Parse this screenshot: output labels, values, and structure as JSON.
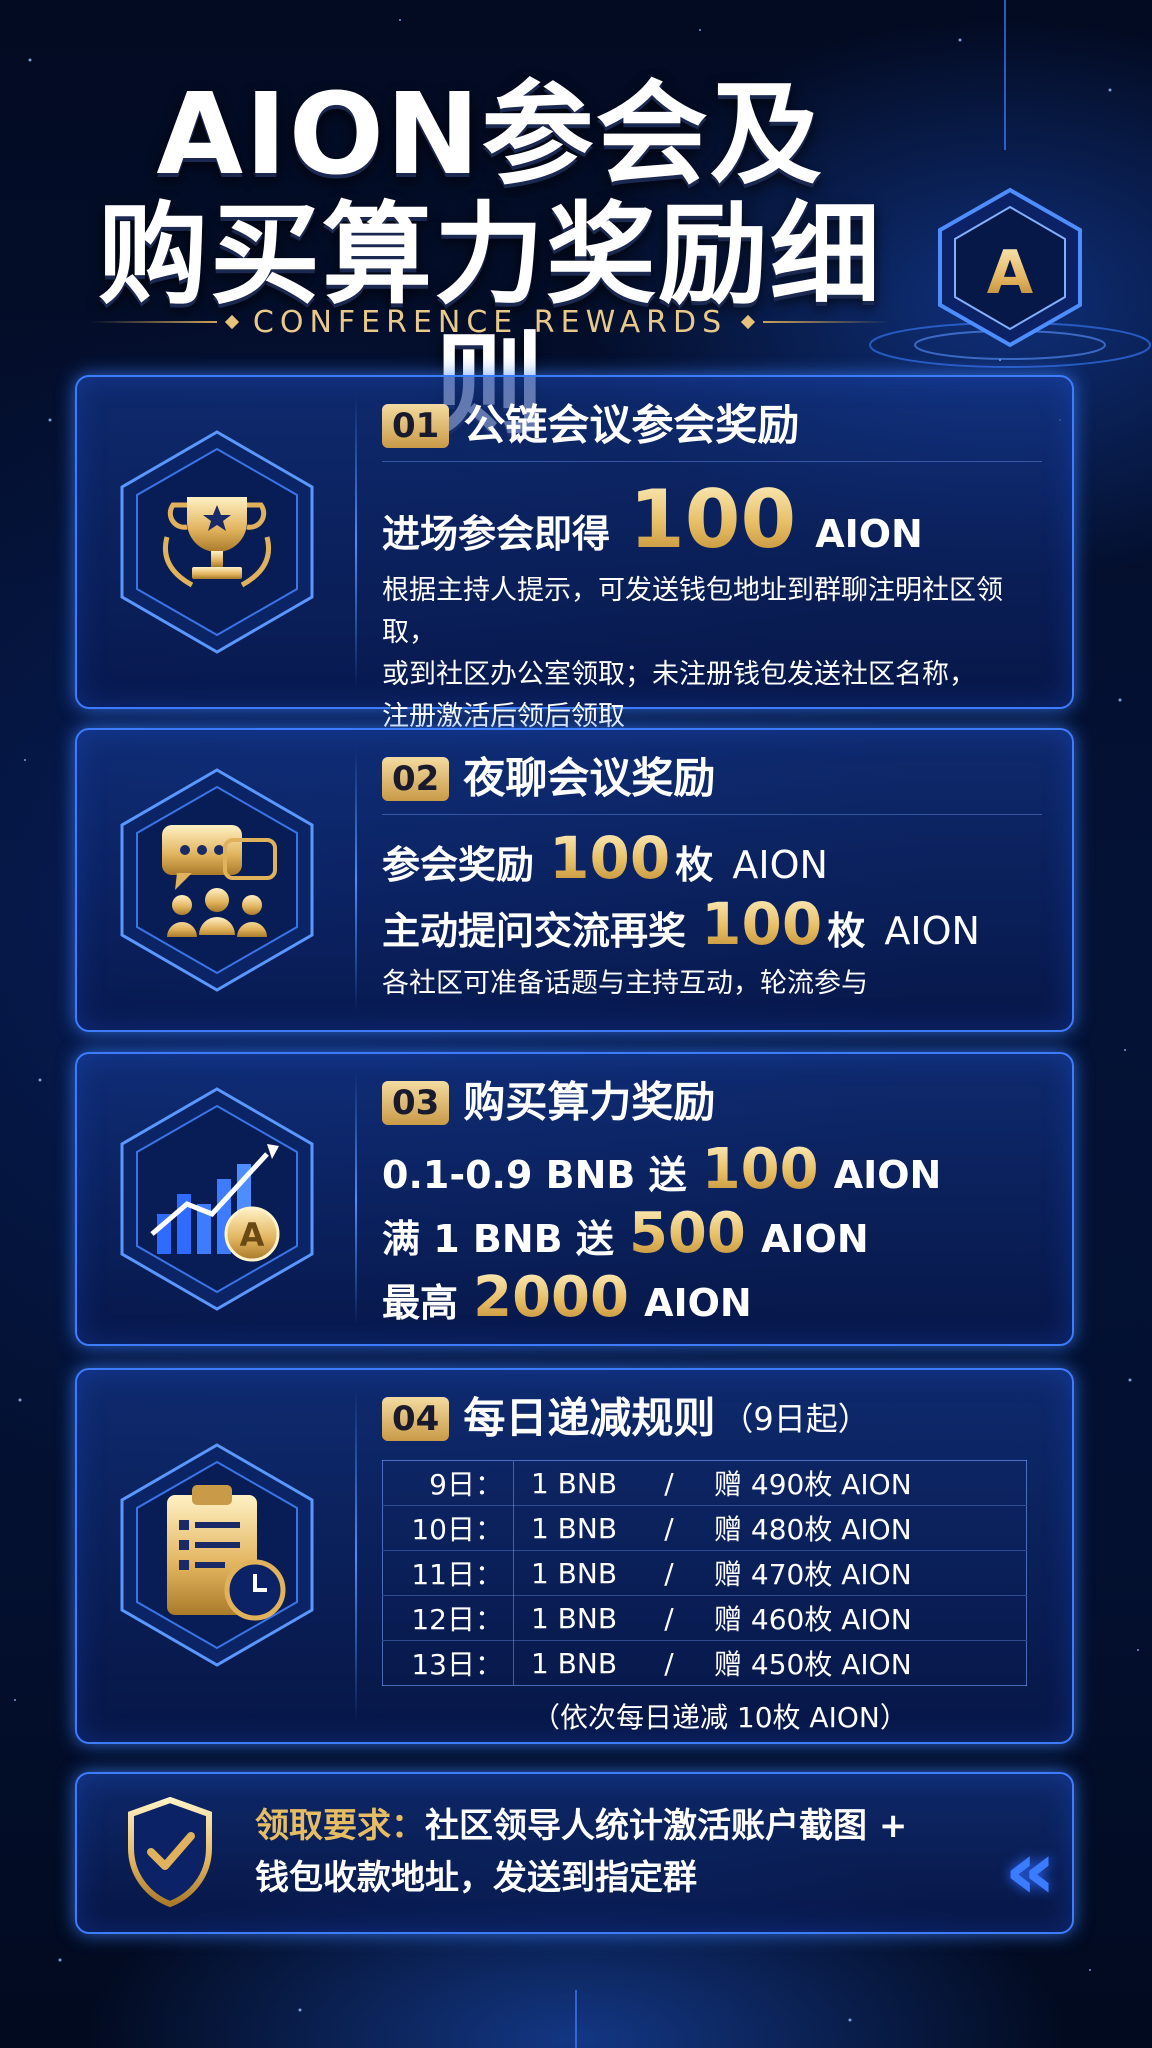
{
  "header": {
    "title_line1": "AION参会及",
    "title_line2": "购买算力奖励细则",
    "subtitle": "CONFERENCE REWARDS",
    "logo_letter": "A"
  },
  "sections": [
    {
      "num": "01",
      "title": "公链会议参会奖励",
      "icon": "trophy-icon",
      "reward_prefix": "进场参会即得",
      "reward_amount": "100",
      "reward_unit": "AION",
      "desc": [
        "根据主持人提示，可发送钱包地址到群聊注明社区领取，",
        "或到社区办公室领取；未注册钱包发送社区名称，",
        "注册激活后领后领取"
      ]
    },
    {
      "num": "02",
      "title": "夜聊会议奖励",
      "icon": "chat-group-icon",
      "line1_prefix": "参会奖励",
      "line1_amount": "100",
      "line1_unit": "枚",
      "line1_token": "AION",
      "line2_prefix": "主动提问交流再奖",
      "line2_amount": "100",
      "line2_unit": "枚",
      "line2_token": "AION",
      "desc": "各社区可准备话题与主持互动，轮流参与"
    },
    {
      "num": "03",
      "title": "购买算力奖励",
      "icon": "growth-chart-icon",
      "tiers": [
        {
          "prefix": "0.1-0.9 BNB 送",
          "amount": "100",
          "token": "AION"
        },
        {
          "prefix": "满 1 BNB 送",
          "amount": "500",
          "token": "AION"
        },
        {
          "prefix": "最高",
          "amount": "2000",
          "token": "AION"
        }
      ]
    },
    {
      "num": "04",
      "title": "每日递减规则",
      "title_note": "（9日起）",
      "icon": "clipboard-clock-icon",
      "rows": [
        {
          "day": "9日：",
          "bnb": "1 BNB",
          "sep": "/",
          "gift": "赠 490枚 AION"
        },
        {
          "day": "10日：",
          "bnb": "1 BNB",
          "sep": "/",
          "gift": "赠 480枚 AION"
        },
        {
          "day": "11日：",
          "bnb": "1 BNB",
          "sep": "/",
          "gift": "赠 470枚 AION"
        },
        {
          "day": "12日：",
          "bnb": "1 BNB",
          "sep": "/",
          "gift": "赠 460枚 AION"
        },
        {
          "day": "13日：",
          "bnb": "1 BNB",
          "sep": "/",
          "gift": "赠 450枚 AION"
        }
      ],
      "footnote": "（依次每日递减 10枚 AION）"
    }
  ],
  "footer": {
    "icon": "shield-check-icon",
    "label": "领取要求：",
    "text1": "社区领导人统计激活账户截图 +",
    "text2": "钱包收款地址，发送到指定群",
    "chevron": "«"
  },
  "colors": {
    "gold": "#e7bd63",
    "accent_blue": "#3d7cff",
    "background": "#030b22"
  }
}
